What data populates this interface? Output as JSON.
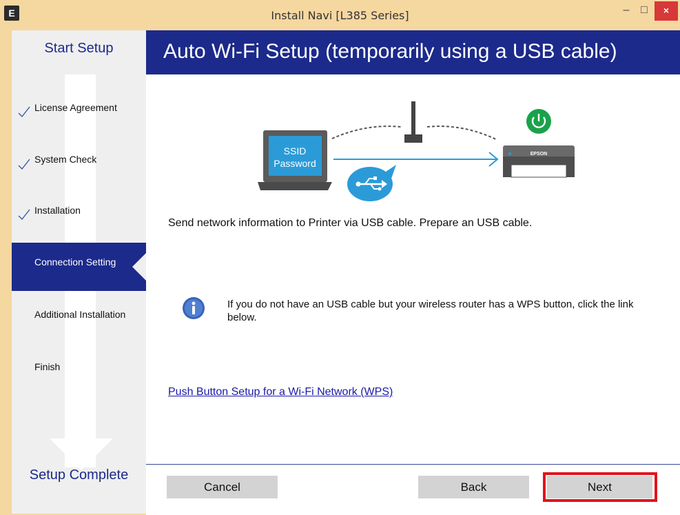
{
  "window": {
    "app_icon_letter": "E",
    "title": "Install Navi [L385 Series]",
    "controls": {
      "minimize": "–",
      "maximize": "□",
      "close": "×"
    }
  },
  "sidebar": {
    "start_label": "Start Setup",
    "end_label": "Setup Complete",
    "steps": [
      {
        "label": "License Agreement",
        "completed": true
      },
      {
        "label": "System Check",
        "completed": true
      },
      {
        "label": "Installation",
        "completed": true
      },
      {
        "label": "Connection Setting",
        "active": true
      },
      {
        "label": "Additional Installation"
      },
      {
        "label": "Finish"
      }
    ]
  },
  "main": {
    "title": "Auto Wi-Fi Setup (temporarily using a USB cable)",
    "illustration": {
      "laptop_line1": "SSID",
      "laptop_line2": "Password",
      "printer_brand": "EPSON"
    },
    "description": "Send network information to Printer via USB cable. Prepare an USB cable.",
    "info_text": "If you do not have an USB cable but your wireless router has a WPS button, click the link below.",
    "wps_link": "Push Button Setup for a Wi-Fi Network (WPS)"
  },
  "buttons": {
    "cancel": "Cancel",
    "back": "Back",
    "next": "Next"
  },
  "colors": {
    "header_blue": "#1c2a8b",
    "highlight_red": "#e0141b",
    "power_green": "#1aa24a",
    "usb_blue": "#2b9bd8"
  }
}
